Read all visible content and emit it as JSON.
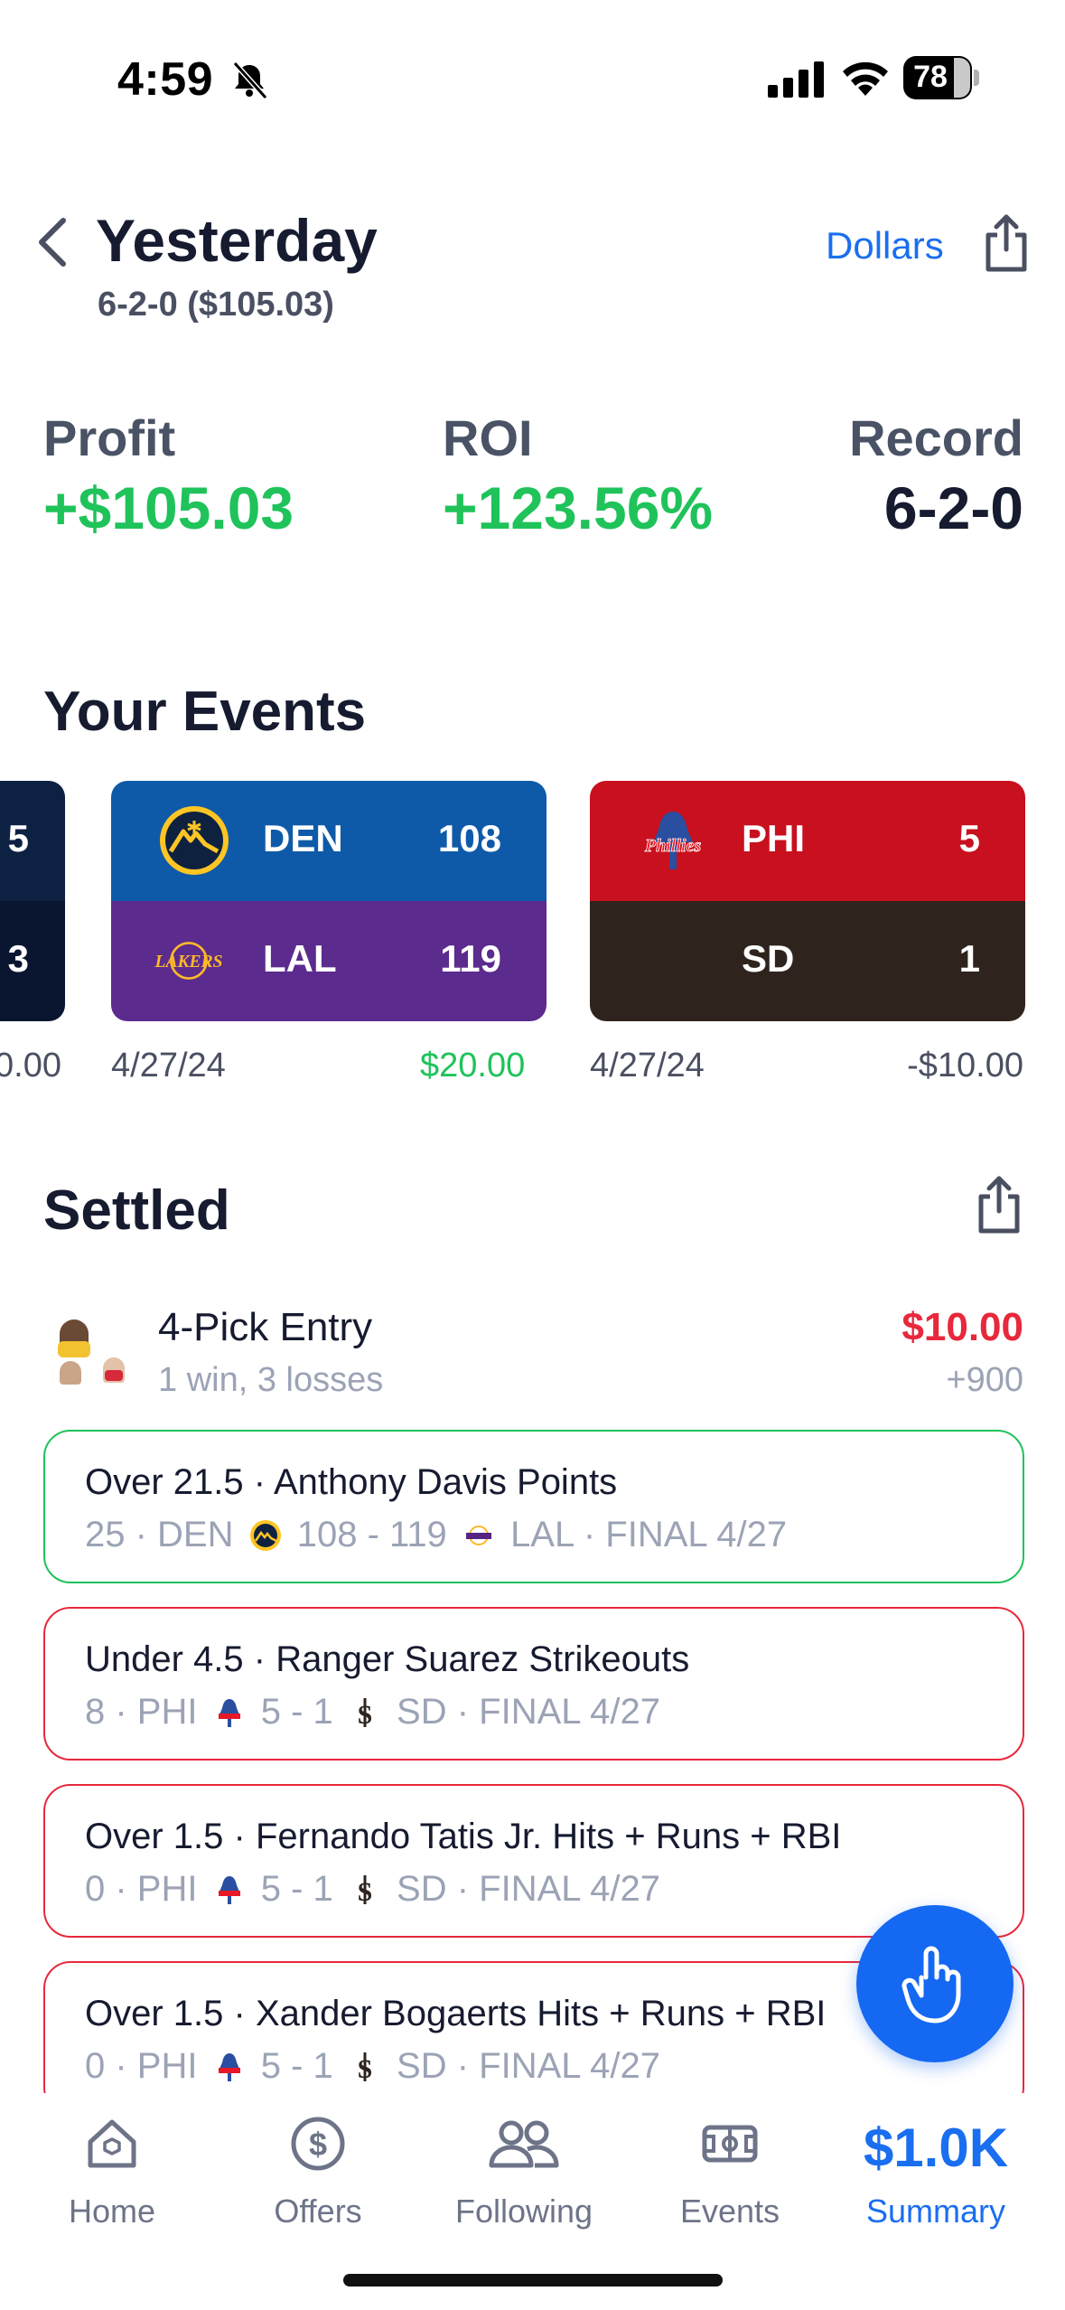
{
  "status_bar": {
    "time": "4:59",
    "battery": "78"
  },
  "header": {
    "title": "Yesterday",
    "subtitle": "6-2-0 ($105.03)",
    "units_toggle": "Dollars"
  },
  "stats": [
    {
      "label": "Profit",
      "value": "+$105.03"
    },
    {
      "label": "ROI",
      "value": "+123.56%"
    },
    {
      "label": "Record",
      "value": "6-2-0"
    }
  ],
  "events_section": {
    "title": "Your Events",
    "partial_card": {
      "top_score": "5",
      "bottom_score": "3",
      "amount": "0.00"
    },
    "cards": [
      {
        "top_team": "DEN",
        "top_score": "108",
        "bottom_team": "LAL",
        "bottom_score": "119",
        "date": "4/27/24",
        "amount": "$20.00",
        "top_color": "#0e5aa8",
        "bottom_color": "#5b2b8e"
      },
      {
        "top_team": "PHI",
        "top_score": "5",
        "bottom_team": "SD",
        "bottom_score": "1",
        "date": "4/27/24",
        "amount": "-$10.00",
        "top_color": "#c8101e",
        "bottom_color": "#2f241d"
      }
    ]
  },
  "settled": {
    "title": "Settled",
    "entry": {
      "title": "4-Pick Entry",
      "subtitle": "1 win, 3 losses",
      "amount": "$10.00",
      "odds": "+900"
    },
    "picks": [
      {
        "title": "Over 21.5 · Anthony Davis Points",
        "stat": "25 · DEN",
        "score": "108 - 119",
        "opp": "LAL · FINAL 4/27",
        "result": "win"
      },
      {
        "title": "Under 4.5 · Ranger Suarez Strikeouts",
        "stat": "8 · PHI",
        "score": "5 - 1",
        "opp": "SD · FINAL 4/27",
        "result": "loss"
      },
      {
        "title": "Over 1.5 · Fernando Tatis Jr. Hits + Runs + RBI",
        "stat": "0 · PHI",
        "score": "5 - 1",
        "opp": "SD · FINAL 4/27",
        "result": "loss"
      },
      {
        "title": "Over 1.5 · Xander Bogaerts Hits + Runs + RBI",
        "stat": "0 · PHI",
        "score": "5 - 1",
        "opp": "SD · FINAL 4/27",
        "result": "loss"
      }
    ]
  },
  "tabbar": {
    "home": "Home",
    "offers": "Offers",
    "following": "Following",
    "events": "Events",
    "summary_value": "$1.0K",
    "summary": "Summary"
  },
  "colors": {
    "accent": "#1a6ef0",
    "positive": "#1fc35a",
    "negative": "#e8283c"
  },
  "icons": [
    "bell-slash-icon",
    "signal-icon",
    "wifi-icon",
    "battery-icon",
    "back-chevron-icon",
    "share-icon",
    "nuggets-logo-icon",
    "lakers-logo-icon",
    "phillies-logo-icon",
    "padres-logo-icon",
    "tap-hand-icon",
    "home-icon",
    "dollar-icon",
    "people-icon",
    "stadium-icon"
  ]
}
